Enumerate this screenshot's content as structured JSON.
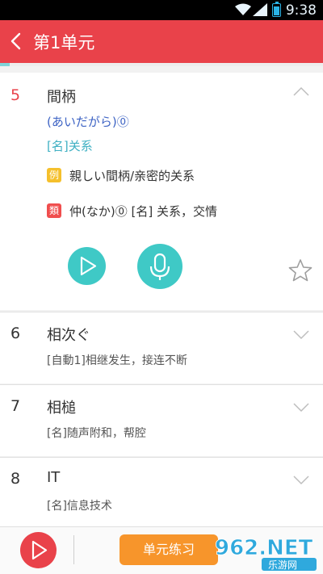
{
  "status_bar": {
    "time": "9:38"
  },
  "header": {
    "title": "第1单元"
  },
  "progress": {
    "fraction": 0.03
  },
  "entries": [
    {
      "number": "5",
      "word": "間柄",
      "reading": "(あいだがら)⓪",
      "pos": "[名]关系",
      "example_tag": "例",
      "example": "親しい間柄/亲密的关系",
      "similar_tag": "類",
      "similar": "仲(なか)⓪ [名] 关系，交情",
      "expanded": true
    },
    {
      "number": "6",
      "word": "相次ぐ",
      "meaning": "[自動1]相继发生，接连不断"
    },
    {
      "number": "7",
      "word": "相槌",
      "meaning": "[名]随声附和，帮腔"
    },
    {
      "number": "8",
      "word": "IT",
      "meaning": "[名]信息技术"
    }
  ],
  "bottom_bar": {
    "practice_label": "单元练习"
  },
  "watermark": {
    "brand": "962.NET",
    "sub": "乐游网"
  },
  "colors": {
    "header": "#e9424a",
    "accent": "#3fc9c6",
    "practice": "#f7952b",
    "number_active": "#e9424a"
  }
}
